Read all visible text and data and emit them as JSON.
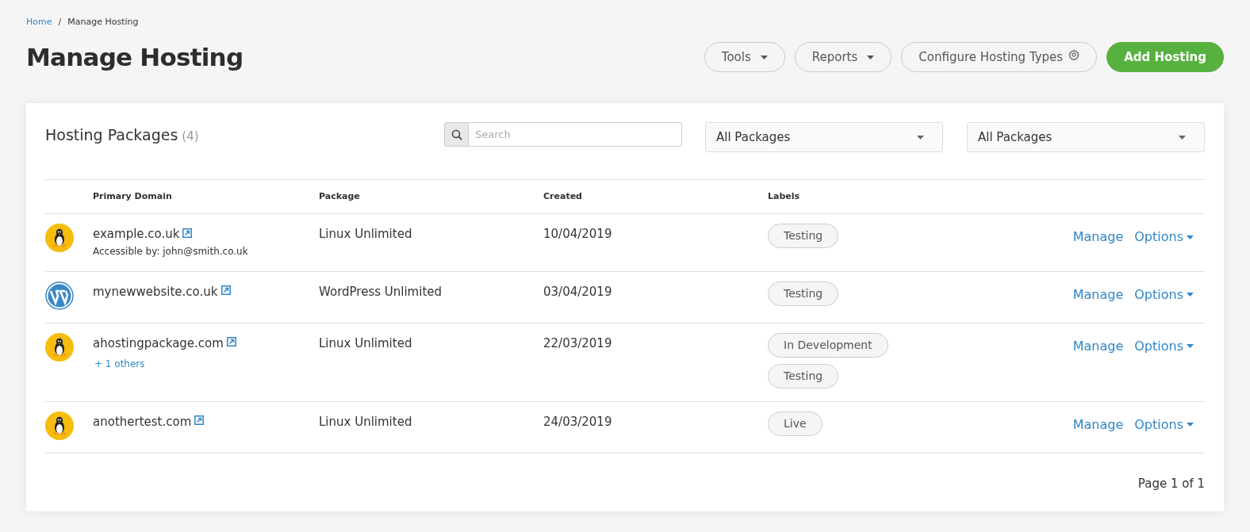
{
  "breadcrumb": [
    {
      "label": "Home",
      "link": true
    },
    {
      "label": "/",
      "link": false
    },
    {
      "label": "Manage Hosting",
      "link": false
    }
  ],
  "title": "Manage Hosting",
  "header_buttons": [
    {
      "label": "Tools",
      "kind": "dropdown"
    },
    {
      "label": "Reports",
      "kind": "dropdown"
    },
    {
      "label": "Configure Hosting Types",
      "kind": "settings"
    },
    {
      "label": "Add Hosting",
      "kind": "primary"
    }
  ],
  "panel": {
    "title": "Hosting Packages",
    "count": "(4)",
    "search": {
      "placeholder": "Search"
    },
    "filters": [
      "All Packages",
      "All Packages"
    ]
  },
  "table": {
    "columns": [
      "Primary Domain",
      "Package",
      "Created",
      "Labels"
    ],
    "rows": [
      {
        "kind": "linux",
        "domain": "example.co.uk",
        "sub": {
          "kind": "note",
          "text": "Accessible by: john@smith.co.uk"
        },
        "package": "Linux Unlimited",
        "created": "10/04/2019",
        "labels": [
          "Testing"
        ],
        "actions": [
          "Manage",
          "Options"
        ]
      },
      {
        "kind": "wordpress",
        "domain": "mynewwebsite.co.uk",
        "package": "WordPress Unlimited",
        "created": "03/04/2019",
        "labels": [
          "Testing"
        ],
        "actions": [
          "Manage",
          "Options"
        ]
      },
      {
        "kind": "linux",
        "domain": "ahostingpackage.com",
        "sub": {
          "kind": "link",
          "text": "+ 1 others"
        },
        "package": "Linux Unlimited",
        "created": "22/03/2019",
        "labels": [
          "In Development",
          "Testing"
        ],
        "actions": [
          "Manage",
          "Options"
        ]
      },
      {
        "kind": "linux",
        "domain": "anothertest.com",
        "package": "Linux Unlimited",
        "created": "24/03/2019",
        "labels": [
          "Live"
        ],
        "actions": [
          "Manage",
          "Options"
        ]
      }
    ]
  },
  "pagination": "Page 1 of 1"
}
